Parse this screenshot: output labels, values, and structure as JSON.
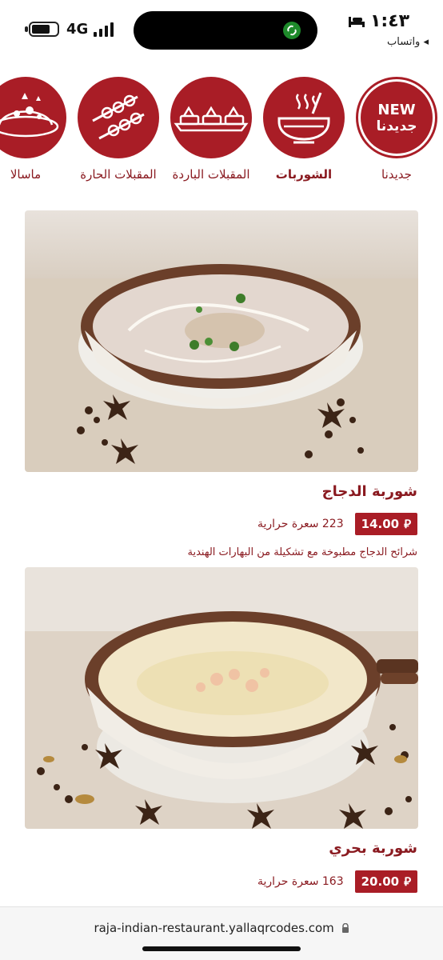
{
  "status": {
    "network": "4G",
    "time": "١:٤٣",
    "back_app": "◂ واتساب"
  },
  "categories": [
    {
      "label": "جديدنا",
      "badge_en": "NEW",
      "badge_ar": "جديدنا",
      "icon": "new-badge"
    },
    {
      "label": "الشوربات",
      "icon": "soup-bowl-icon",
      "selected": true
    },
    {
      "label": "المقبلات الباردة",
      "icon": "cold-appetizers-icon"
    },
    {
      "label": "المقبلات الحارة",
      "icon": "skewers-icon"
    },
    {
      "label": "ماسالا",
      "icon": "masala-plate-icon"
    }
  ],
  "items": [
    {
      "title": "شوربة الدجاج",
      "price": "14.00",
      "currency_symbol": "⃁",
      "calories": "223 سعرة حرارية",
      "description": "شرائح الدجاج مطبوخة مع تشكيلة من البهارات الهندية"
    },
    {
      "title": "شوربة بحري",
      "price": "20.00",
      "currency_symbol": "⃁",
      "calories": "163 سعرة حرارية"
    }
  ],
  "browser": {
    "url": "raja-indian-restaurant.yallaqrcodes.com"
  },
  "colors": {
    "brand": "#a91d26",
    "brand_text": "#8a1a20"
  }
}
